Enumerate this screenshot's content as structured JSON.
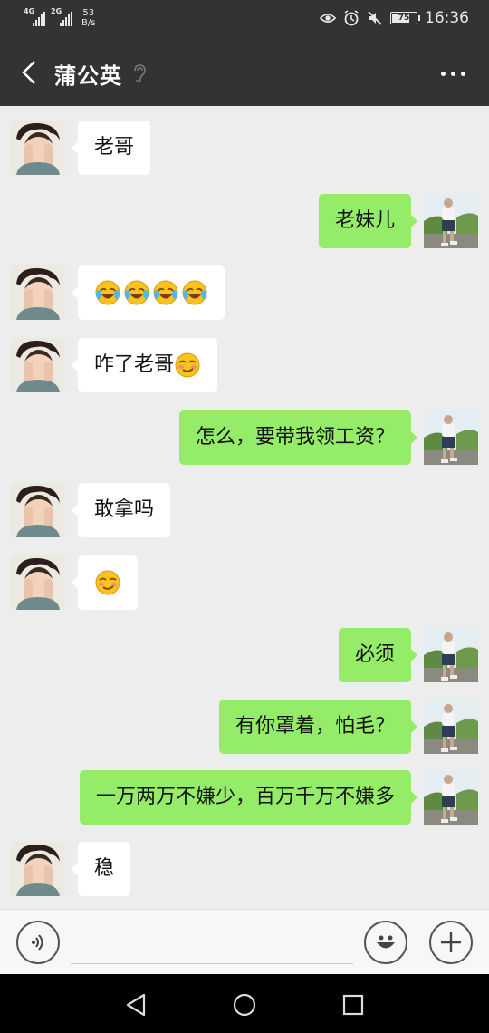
{
  "status_bar": {
    "signal1_label": "4G",
    "signal2_label": "2G",
    "speed_value": "53",
    "speed_unit": "B/s",
    "battery": "75",
    "battery_level": 0.75,
    "time": "16:36"
  },
  "header": {
    "title": "蒲公英",
    "back_icon": "chevron-left-icon",
    "ear_icon": "earpiece-mode-icon",
    "more_icon": "more-dots-icon",
    "background": "#333333"
  },
  "colors": {
    "chat_background": "#ededed",
    "sent_bubble": "#95ec69",
    "received_bubble": "#ffffff"
  },
  "messages": [
    {
      "side": "left",
      "text": "老哥",
      "emoji": ""
    },
    {
      "side": "right",
      "text": "老妹儿",
      "emoji": ""
    },
    {
      "side": "left",
      "text": "",
      "emoji": "laugh-cry-emoji ×4"
    },
    {
      "side": "left",
      "text": "咋了老哥",
      "emoji": "smirk-emoji"
    },
    {
      "side": "right",
      "text": "怎么，要带我领工资？",
      "emoji": ""
    },
    {
      "side": "left",
      "text": "敢拿吗",
      "emoji": ""
    },
    {
      "side": "left",
      "text": "",
      "emoji": "smirk-emoji"
    },
    {
      "side": "right",
      "text": "必须",
      "emoji": ""
    },
    {
      "side": "right",
      "text": "有你罩着，怕毛？",
      "emoji": ""
    },
    {
      "side": "right",
      "text": "一万两万不嫌少，百万千万不嫌多",
      "emoji": ""
    },
    {
      "side": "left",
      "text": "稳",
      "emoji": ""
    }
  ],
  "input_bar": {
    "voice_icon": "voice-icon",
    "emoji_icon": "emoji-icon",
    "plus_icon": "plus-icon",
    "input_value": ""
  },
  "nav_bar": {
    "back_icon": "triangle-back-icon",
    "home_icon": "circle-home-icon",
    "recent_icon": "square-recent-icon"
  }
}
